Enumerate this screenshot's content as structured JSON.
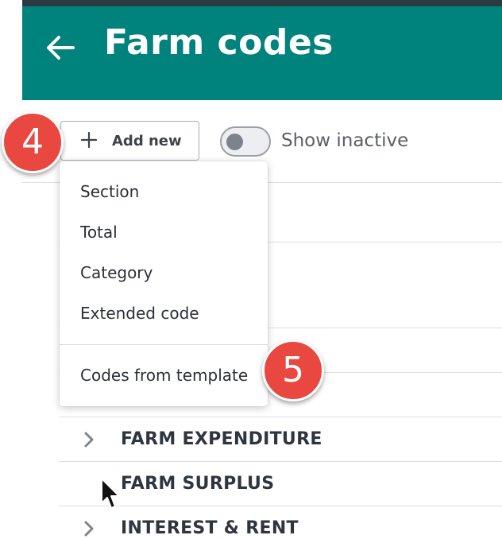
{
  "header": {
    "title": "Farm codes",
    "back_icon": "arrow-left-icon",
    "color": "#00827d"
  },
  "toolbar": {
    "add_new_label": "Add new",
    "add_icon": "plus-icon",
    "show_inactive_label": "Show inactive",
    "show_inactive_on": false
  },
  "annotations": {
    "step_a": "4",
    "step_b": "5",
    "color": "#e8483f"
  },
  "dropdown": {
    "items": [
      {
        "label": "Section"
      },
      {
        "label": "Total"
      },
      {
        "label": "Category"
      },
      {
        "label": "Extended code"
      },
      {
        "label": "Codes from template"
      }
    ]
  },
  "list": {
    "rows": [
      {
        "label": "FARM EXPENDITURE",
        "expandable": true
      },
      {
        "label": "FARM SURPLUS",
        "expandable": false
      },
      {
        "label": "INTEREST & RENT",
        "expandable": true
      }
    ]
  }
}
